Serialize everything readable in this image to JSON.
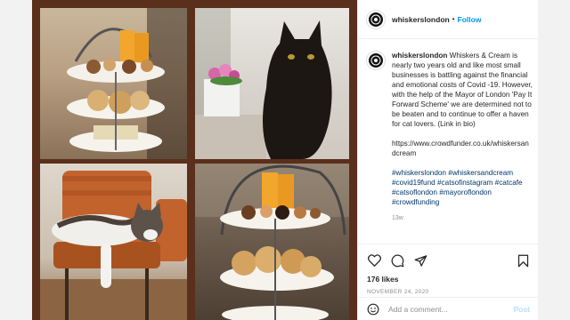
{
  "post": {
    "username": "whiskerslondon",
    "avatar_icon": "whiskers-logo-icon",
    "follow_label": "Follow",
    "separator": "•",
    "caption_user": "whiskerslondon",
    "caption_body": "Whiskers & Cream is nearly two years old and like most small businesses is battling against the financial and emotional costs of Covid -19. However, with the help of the Mayor of London 'Pay It Forward Scheme' we are determined not to be beaten and to continue to offer a haven for cat lovers. (Link in bio)",
    "link": "https://www.crowdfunder.co.uk/whiskersandcream",
    "hashtags": [
      "#whiskerslondon",
      "#whiskersandcream",
      "#covid19fund",
      "#catsofinstagram",
      "#catcafe",
      "#catsoflondon",
      "#mayoroflondon",
      "#crowdfunding"
    ],
    "time_ago": "13w",
    "likes": "176 likes",
    "date": "NOVEMBER 24, 2020",
    "comment_placeholder": "Add a comment...",
    "post_button": "Post"
  },
  "icons": [
    "heart-icon",
    "comment-icon",
    "share-icon",
    "bookmark-icon",
    "emoji-icon"
  ],
  "colors": {
    "accent": "#0095f6",
    "frame": "#5a2f1b",
    "muted": "#8e8e8e",
    "hashtag": "#00376b"
  }
}
